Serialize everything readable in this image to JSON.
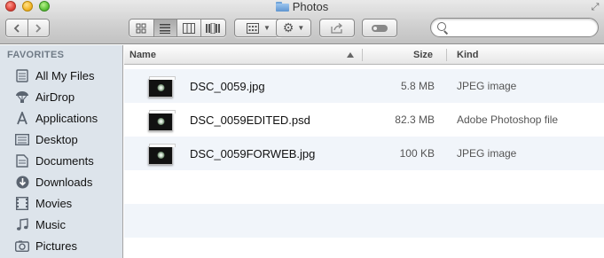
{
  "window": {
    "title": "Photos"
  },
  "toolbar": {
    "back_icon": "chevron-left-icon",
    "forward_icon": "chevron-right-icon",
    "view_modes": [
      "icon-view",
      "list-view",
      "column-view",
      "coverflow-view"
    ],
    "active_view": "list-view",
    "arrange_icon": "arrange-grid-icon",
    "action_icon": "gear-icon",
    "share_icon": "share-icon",
    "tag_icon": "tag-icon",
    "search": {
      "placeholder": "",
      "value": ""
    }
  },
  "sidebar": {
    "header": "FAVORITES",
    "items": [
      {
        "label": "All My Files",
        "icon": "all-files-icon"
      },
      {
        "label": "AirDrop",
        "icon": "airdrop-icon"
      },
      {
        "label": "Applications",
        "icon": "applications-icon"
      },
      {
        "label": "Desktop",
        "icon": "desktop-icon"
      },
      {
        "label": "Documents",
        "icon": "documents-icon"
      },
      {
        "label": "Downloads",
        "icon": "downloads-icon"
      },
      {
        "label": "Movies",
        "icon": "movies-icon"
      },
      {
        "label": "Music",
        "icon": "music-icon"
      },
      {
        "label": "Pictures",
        "icon": "pictures-icon"
      }
    ]
  },
  "list": {
    "columns": {
      "name": "Name",
      "size": "Size",
      "kind": "Kind"
    },
    "sort": {
      "column": "name",
      "direction": "ascending"
    },
    "rows": [
      {
        "name": "DSC_0059.jpg",
        "size": "5.8 MB",
        "kind": "JPEG image"
      },
      {
        "name": "DSC_0059EDITED.psd",
        "size": "82.3 MB",
        "kind": "Adobe Photoshop file"
      },
      {
        "name": "DSC_0059FORWEB.jpg",
        "size": "100 KB",
        "kind": "JPEG image"
      }
    ]
  }
}
